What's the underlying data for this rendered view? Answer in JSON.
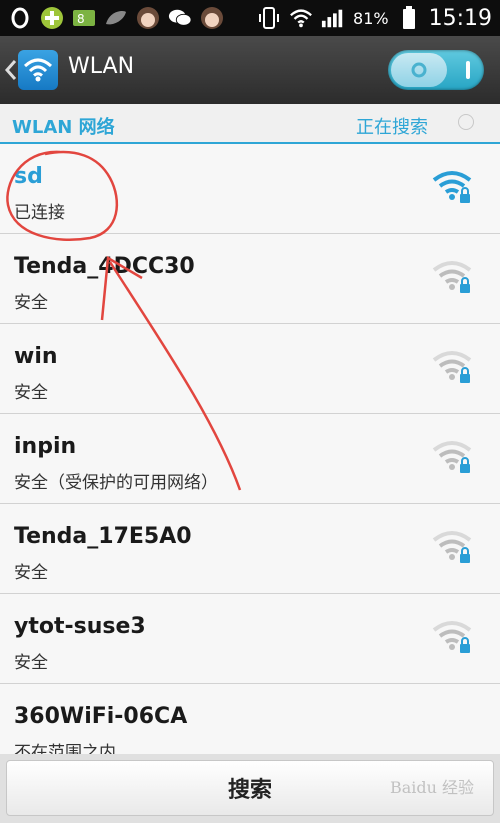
{
  "status_bar": {
    "battery_percent": "81%",
    "time": "15:19",
    "notification_icons": [
      "circle-o-icon",
      "app-green-icon",
      "battery-8-icon",
      "leaf-icon",
      "avatar-icon",
      "wechat-icon",
      "avatar-icon"
    ]
  },
  "action_bar": {
    "title": "WLAN",
    "toggle_state": "on"
  },
  "section": {
    "title": "WLAN 网络",
    "status": "正在搜索"
  },
  "networks": [
    {
      "name": "sd",
      "status": "已连接",
      "connected": true,
      "signal": "strong",
      "color": "#2a9ed6"
    },
    {
      "name": "Tenda_4DCC30",
      "status": "安全",
      "connected": false,
      "signal": "weak"
    },
    {
      "name": "win",
      "status": "安全",
      "connected": false,
      "signal": "weak"
    },
    {
      "name": "inpin",
      "status": "安全（受保护的可用网络）",
      "connected": false,
      "signal": "weak"
    },
    {
      "name": "Tenda_17E5A0",
      "status": "安全",
      "connected": false,
      "signal": "weak"
    },
    {
      "name": "ytot-suse3",
      "status": "安全",
      "connected": false,
      "signal": "weak"
    },
    {
      "name": "360WiFi-06CA",
      "status": "不在范围之内",
      "connected": false,
      "signal": "none"
    }
  ],
  "bottom": {
    "search_label": "搜索",
    "watermark": "Baidu 经验"
  },
  "colors": {
    "accent": "#2ea6d6",
    "annotation": "#e2463f"
  }
}
